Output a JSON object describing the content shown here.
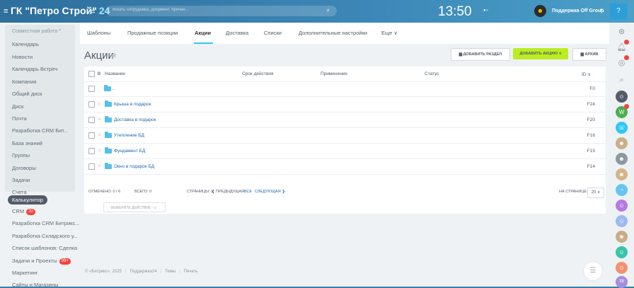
{
  "topbar": {
    "company": "ГК \"Петро Строй\"",
    "company_count": "24",
    "search_placeholder": "искать сотрудника, документ, прочее...",
    "clock": "13:50",
    "support_name": "Поддержка Off Group"
  },
  "sidebar": {
    "section_head": "Совместная работа ^",
    "items": [
      "Календарь",
      "Новости",
      "Календарь Встреч",
      "Компания",
      "Общий диск",
      "Диск",
      "Почта",
      "Разработка CRM Бит...",
      "База знаний",
      "Группы",
      "Договоры",
      "Задачи",
      "Счета"
    ],
    "active": "Калькулятор",
    "crm_label": "CRM",
    "crm_badge": "20",
    "lower_items": [
      "Разработка CRM Битрикс...",
      "Разработка Складского у...",
      "Список шаблонов: Сделка"
    ],
    "tasks_label": "Задачи и Проекты",
    "tasks_badge": "99+",
    "tail_items": [
      "Маркетинг",
      "Сайты и Магазины"
    ]
  },
  "tabs": [
    "Шаблоны",
    "Продажные позиции",
    "Акции",
    "Доставка",
    "Списки",
    "Дополнительные настройки",
    "Еще ∨"
  ],
  "page": {
    "title": "Акции",
    "btn_add_section": "ДОБАВИТЬ РАЗДЕЛ",
    "btn_add_action": "ДОБАВИТЬ АКЦИЮ ∨",
    "btn_archive": "АРХИВ"
  },
  "grid": {
    "columns": {
      "name": "Название",
      "term": "Срок действия",
      "apply": "Применение",
      "status": "Статус",
      "id": "ID ∨"
    },
    "rows": [
      {
        "name": "..",
        "id": "F0"
      },
      {
        "name": "Крыша в подарок",
        "id": "F24"
      },
      {
        "name": "Доставка в подарок",
        "id": "F20"
      },
      {
        "name": "Утепление БД",
        "id": "F16"
      },
      {
        "name": "Фундамент БД",
        "id": "F15"
      },
      {
        "name": "Окно в подарок БД",
        "id": "F14"
      }
    ],
    "footer": {
      "marked": "ОТМЕЧЕНО: 0 / 6",
      "total": "ВСЕГО: 0",
      "pages": "СТРАНИЦЫ: 1",
      "prev": "❮ ПРЕДЫДУЩАЯ",
      "all": "ВСЕ",
      "next": "СЛЕДУЮЩАЯ ❯",
      "per_page_label": "НА СТРАНИЦЕ:",
      "per_page": "20 ∨",
      "actions_select": "- ВЫБЕРИТЕ ДЕЙСТВИЕ -  ∨"
    }
  },
  "footer": {
    "copyright": "© «Битрикс», 2025",
    "links": [
      "Поддержка24",
      "Темы",
      "Печать"
    ]
  },
  "rightbar": {
    "last_badge": "38"
  }
}
